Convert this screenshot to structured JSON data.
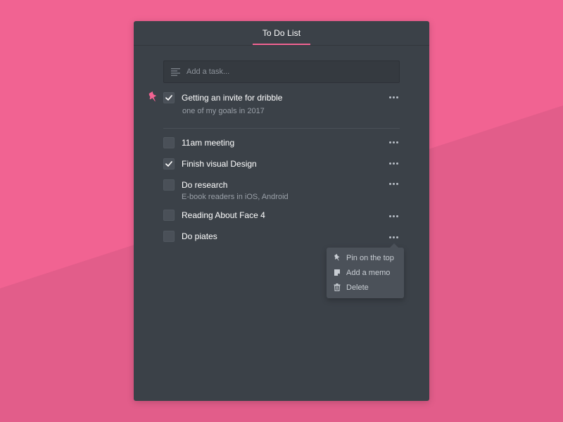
{
  "colors": {
    "background": "#f16392",
    "background_shade": "#e25d8a",
    "window": "#3b4148",
    "accent": "#f16392",
    "checkbox": "#4a5058",
    "menu": "#4b5159"
  },
  "window": {
    "title": "To Do List"
  },
  "add_task": {
    "placeholder": "Add a task...",
    "icon": "lines-icon"
  },
  "pinned_task": {
    "label": "Getting an invite for dribble",
    "memo": "one of my goals in 2017",
    "checked": true,
    "pinned": true,
    "pin_icon": "pin-icon"
  },
  "tasks": [
    {
      "label": "11am meeting",
      "checked": false,
      "memo": ""
    },
    {
      "label": "Finish visual Design",
      "checked": true,
      "memo": ""
    },
    {
      "label": "Do research",
      "checked": false,
      "memo": "E-book readers in iOS, Android"
    },
    {
      "label": "Reading About Face 4",
      "checked": false,
      "memo": ""
    },
    {
      "label": "Do piates",
      "checked": false,
      "memo": ""
    }
  ],
  "context_menu": {
    "items": [
      {
        "label": "Pin on the top",
        "icon": "pin-icon"
      },
      {
        "label": "Add a memo",
        "icon": "memo-icon"
      },
      {
        "label": "Delete",
        "icon": "trash-icon"
      }
    ]
  }
}
